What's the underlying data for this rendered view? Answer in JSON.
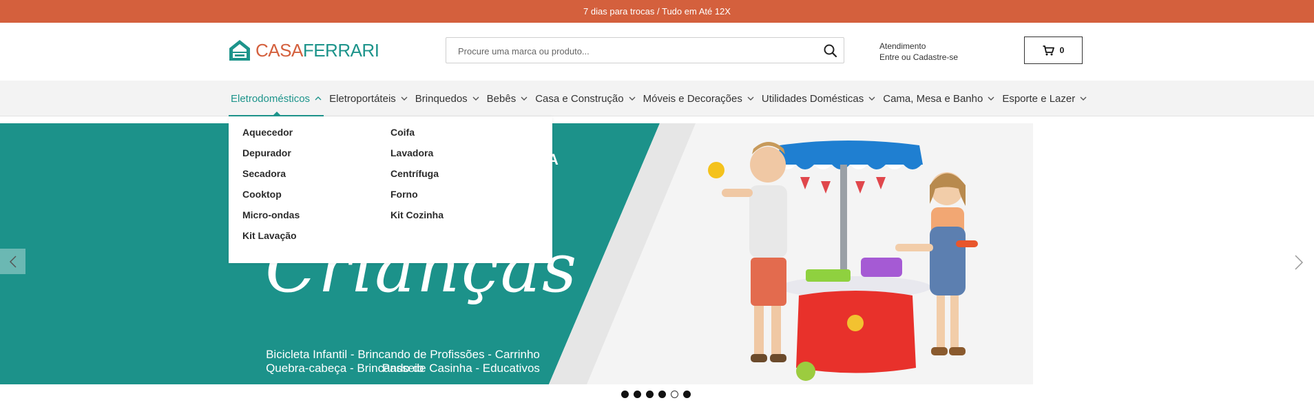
{
  "topbar": {
    "text": "7 dias para trocas / Tudo em Até 12X"
  },
  "header": {
    "logo": {
      "casa": "CASA",
      "ferrari": "FERRARI"
    },
    "search": {
      "placeholder": "Procure uma marca ou produto...",
      "icon": "search-icon"
    },
    "account": {
      "title": "Atendimento",
      "link": "Entre ou Cadastre-se"
    },
    "cart": {
      "count": "0",
      "icon": "cart-icon"
    }
  },
  "nav": {
    "items": [
      {
        "label": "Eletrodomésticos",
        "active": true
      },
      {
        "label": "Eletroportáteis"
      },
      {
        "label": "Brinquedos"
      },
      {
        "label": "Bebês"
      },
      {
        "label": "Casa e Construção"
      },
      {
        "label": "Móveis e Decorações"
      },
      {
        "label": "Utilidades Domésticas"
      },
      {
        "label": "Cama, Mesa e Banho"
      },
      {
        "label": "Esporte e Lazer"
      }
    ]
  },
  "dropdown": {
    "col1": [
      "Aquecedor",
      "Depurador",
      "Secadora",
      "Cooktop",
      "Micro-ondas",
      "Kit Lavação"
    ],
    "col2": [
      "Coifa",
      "Lavadora",
      "Centrífuga",
      "Forno",
      "Kit Cozinha"
    ]
  },
  "hero": {
    "headline_fragment": "A",
    "script_text": "Crianças",
    "subline1": "Bicicleta Infantil - Brincando de Profissões - Carrinho Passeio",
    "subline2": "Quebra-cabeça - Brincando de Casinha - Educativos"
  },
  "slider": {
    "dots": 6,
    "active_dot": 5
  },
  "colors": {
    "accent": "#1d948b",
    "brand_orange": "#d4603d",
    "nav_bg": "#f3f3f3"
  }
}
